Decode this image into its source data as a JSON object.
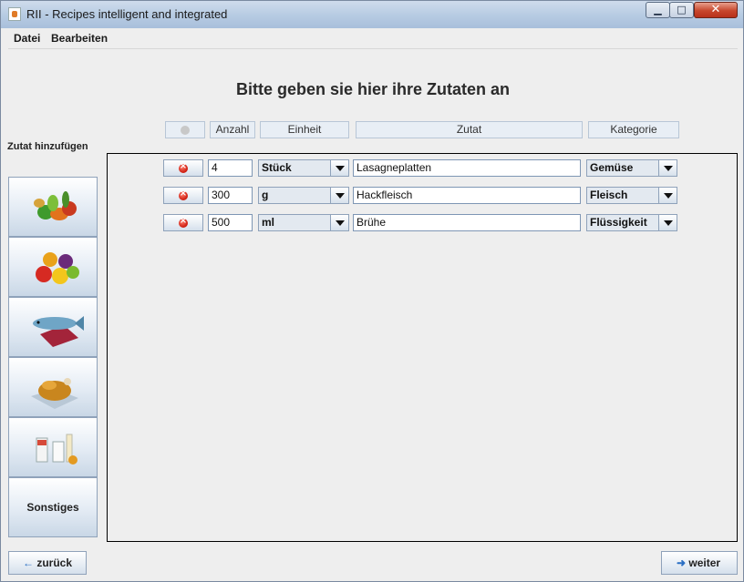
{
  "window": {
    "title": "RII - Recipes intelligent and integrated"
  },
  "menu": [
    "Datei",
    "Bearbeiten"
  ],
  "heading": "Bitte geben sie hier ihre Zutaten an",
  "columns": {
    "anzahl": "Anzahl",
    "einheit": "Einheit",
    "zutat": "Zutat",
    "kategorie": "Kategorie"
  },
  "sidebar": {
    "label": "Zutat hinzufügen",
    "categories": [
      {
        "icon": "vegetables-icon"
      },
      {
        "icon": "fruit-icon"
      },
      {
        "icon": "fish-meat-icon"
      },
      {
        "icon": "poultry-icon"
      },
      {
        "icon": "drinks-dairy-icon"
      },
      {
        "label": "Sonstiges"
      }
    ]
  },
  "rows": [
    {
      "anzahl": "4",
      "einheit": "Stück",
      "zutat": "Lasagneplatten",
      "kategorie": "Gemüse"
    },
    {
      "anzahl": "300",
      "einheit": "g",
      "zutat": "Hackfleisch",
      "kategorie": "Fleisch"
    },
    {
      "anzahl": "500",
      "einheit": "ml",
      "zutat": "Brühe",
      "kategorie": "Flüssigkeit"
    }
  ],
  "nav": {
    "back_icon": "←",
    "back": "zurück",
    "next_icon": "➜",
    "next": "weiter"
  }
}
